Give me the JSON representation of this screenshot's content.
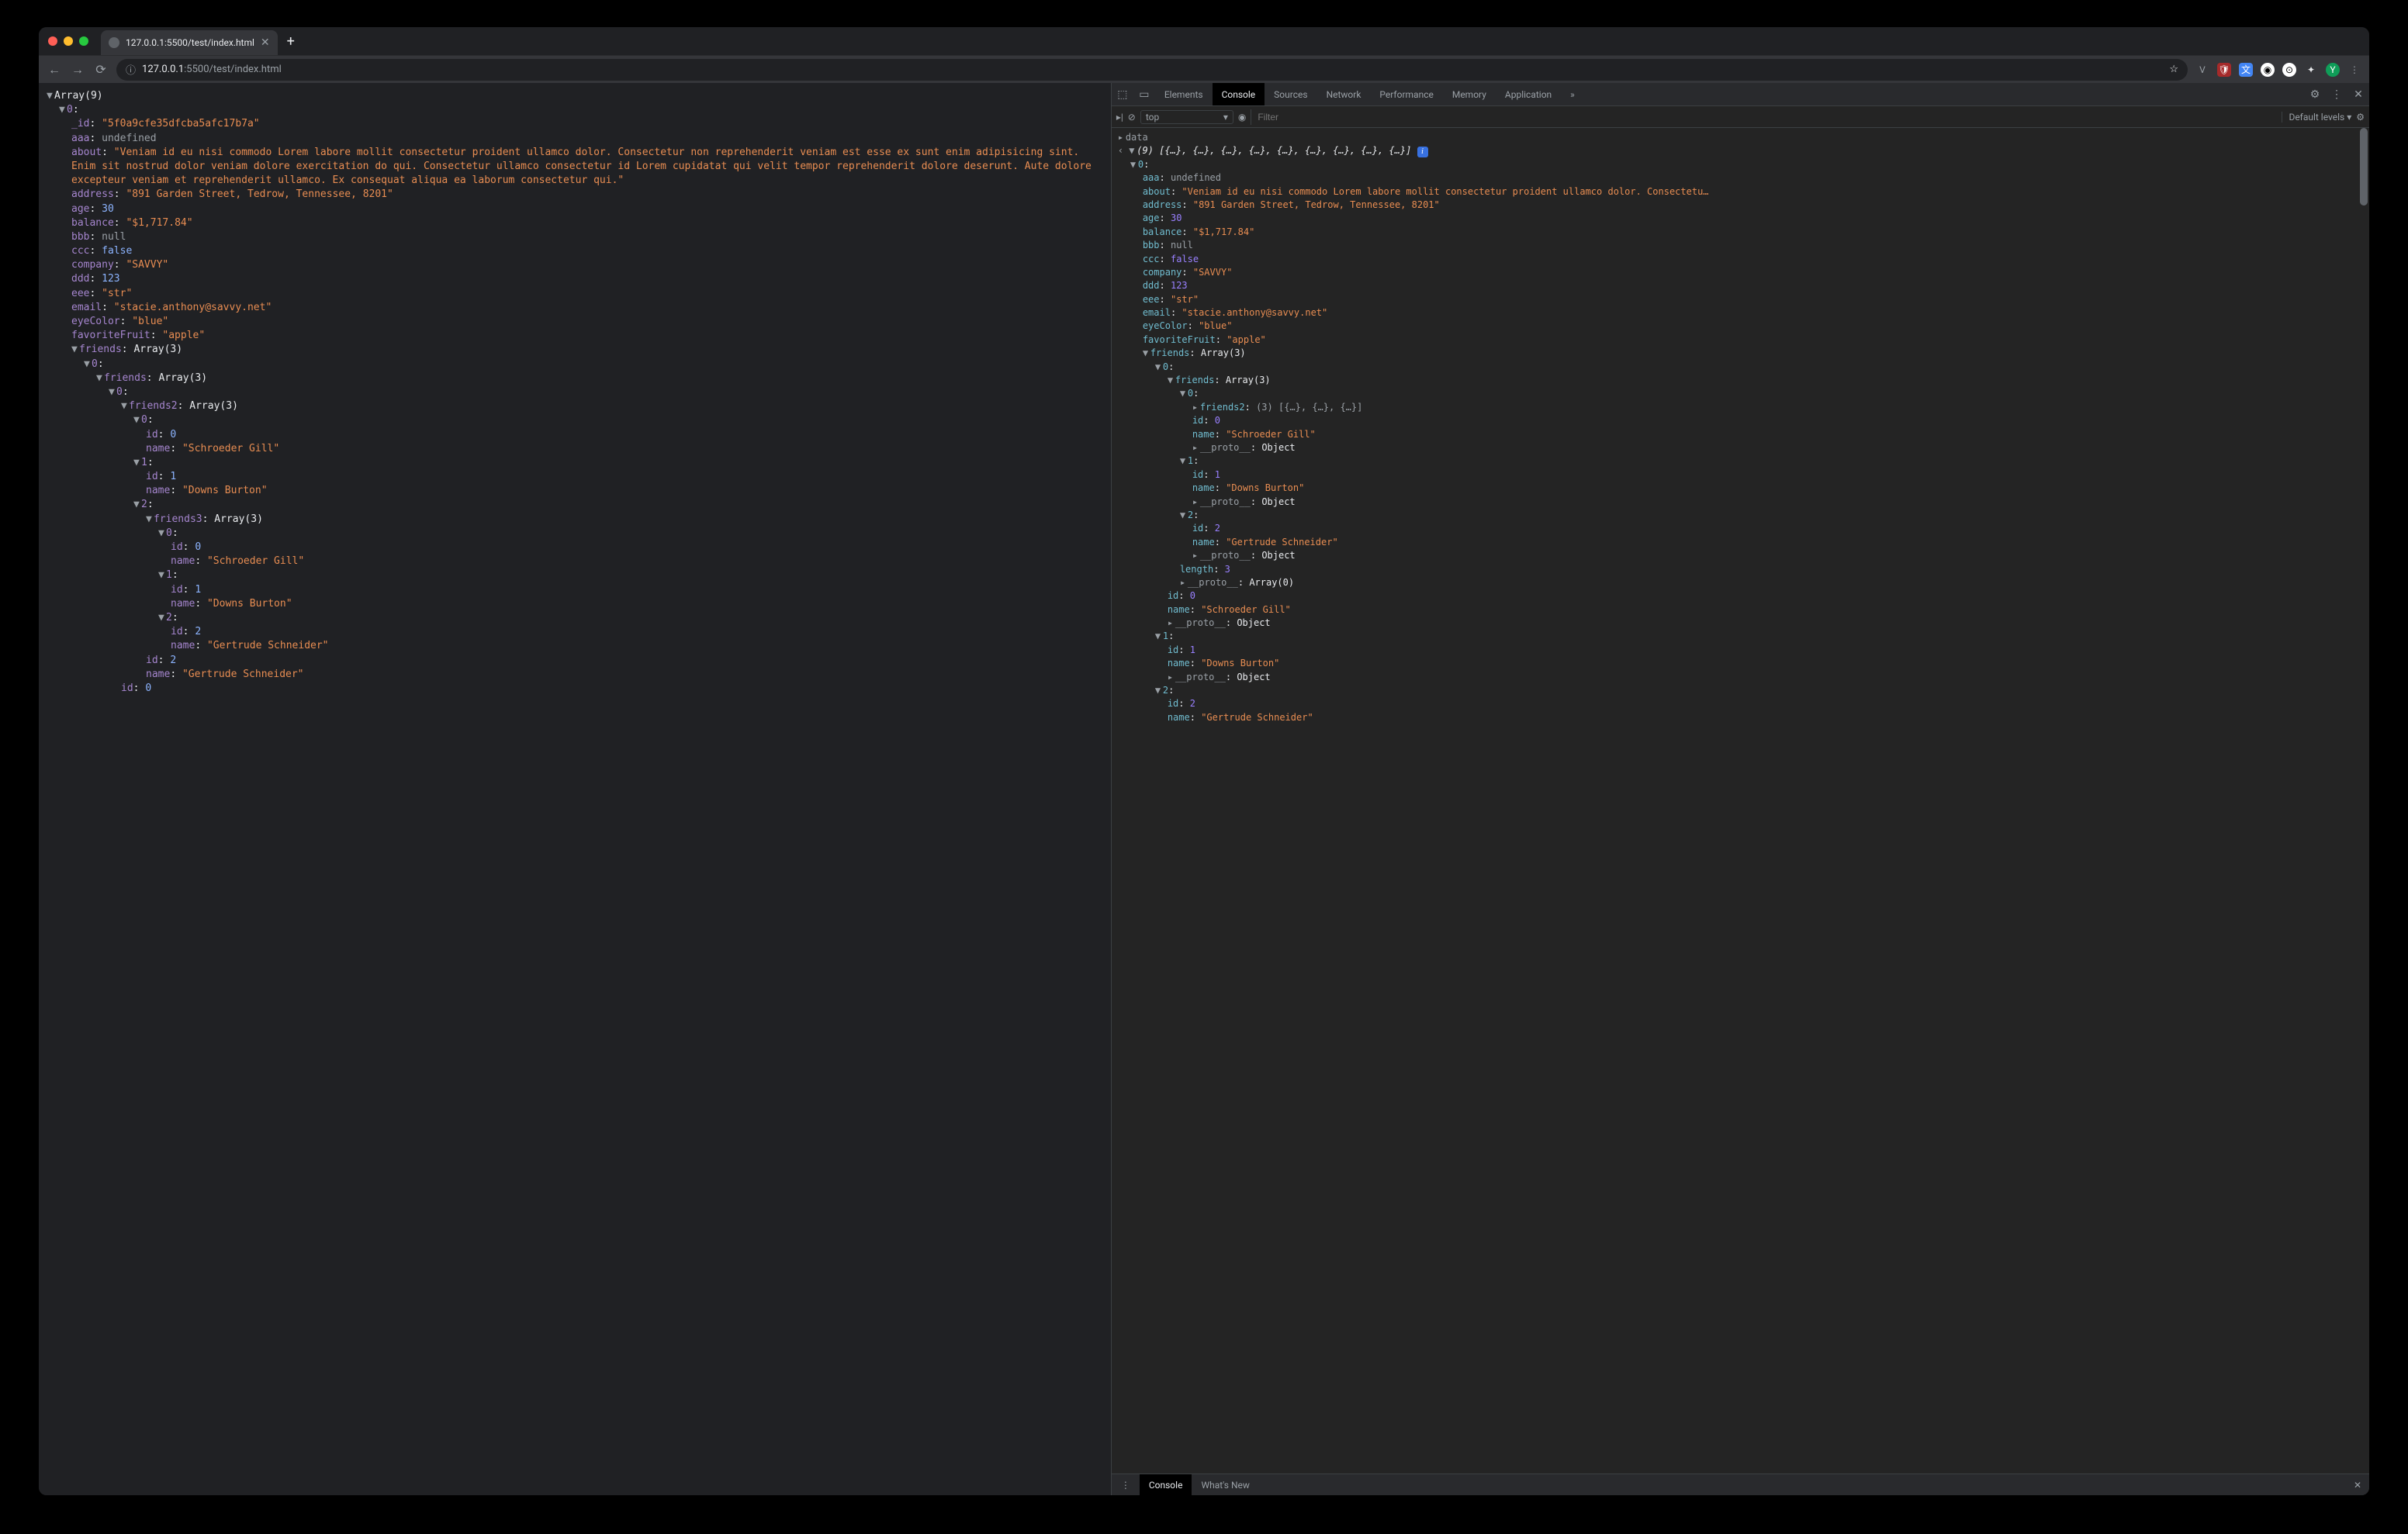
{
  "browser": {
    "tab_title": "127.0.0.1:5500/test/index.html",
    "url_info": "ⓘ",
    "url_host": "127.0.0.1",
    "url_port_path": ":5500/test/index.html",
    "star": "☆",
    "avatar_letter": "Y",
    "newtab": "+",
    "back": "←",
    "fwd": "→",
    "reload": "⟳",
    "ext_v": "V",
    "ext_puzzle": "✦",
    "ext_more": "⋮",
    "ext_gh": "⊙",
    "ext_robot": "◉",
    "ext_trans": "文",
    "ext_shield": "🛡"
  },
  "devtools": {
    "tabs": {
      "elements": "Elements",
      "console": "Console",
      "sources": "Sources",
      "network": "Network",
      "performance": "Performance",
      "memory": "Memory",
      "application": "Application",
      "more": "»",
      "settings": "⚙",
      "menu": "⋮",
      "close": "✕"
    },
    "toolbar": {
      "clear": "⊘",
      "context": "top",
      "context_arrow": "▾",
      "eye": "◉",
      "filter_placeholder": "Filter",
      "levels": "Default levels ▾",
      "gear": "⚙",
      "side": "▸|"
    },
    "drawer": {
      "menu": "⋮",
      "console": "Console",
      "whatsnew": "What's New",
      "close": "✕"
    }
  },
  "page_tree": {
    "root": "Array(9)",
    "idx0": "0",
    "_id_k": "_id",
    "_id_v": "\"5f0a9cfe35dfcba5afc17b7a\"",
    "aaa_k": "aaa",
    "aaa_v": "undefined",
    "about_k": "about",
    "about_v": "\"Veniam id eu nisi commodo Lorem labore mollit consectetur proident ullamco dolor. Consectetur non reprehenderit veniam est esse ex sunt enim adipisicing sint. Enim sit nostrud dolor veniam dolore exercitation do qui. Consectetur ullamco consectetur id Lorem cupidatat qui velit tempor reprehenderit dolore deserunt. Aute dolore excepteur veniam et reprehenderit ullamco. Ex consequat aliqua ea laborum consectetur qui.\"",
    "address_k": "address",
    "address_v": "\"891 Garden Street, Tedrow, Tennessee, 8201\"",
    "age_k": "age",
    "age_v": "30",
    "balance_k": "balance",
    "balance_v": "\"$1,717.84\"",
    "bbb_k": "bbb",
    "bbb_v": "null",
    "ccc_k": "ccc",
    "ccc_v": "false",
    "company_k": "company",
    "company_v": "\"SAVVY\"",
    "ddd_k": "ddd",
    "ddd_v": "123",
    "eee_k": "eee",
    "eee_v": "\"str\"",
    "email_k": "email",
    "email_v": "\"stacie.anthony@savvy.net\"",
    "eyeColor_k": "eyeColor",
    "eyeColor_v": "\"blue\"",
    "favoriteFruit_k": "favoriteFruit",
    "favoriteFruit_v": "\"apple\"",
    "friends_k": "friends",
    "friends_v": "Array(3)",
    "f0": "0",
    "f0_friends_k": "friends",
    "f0_friends_v": "Array(3)",
    "f00": "0",
    "f00_friends2_k": "friends2",
    "f00_friends2_v": "Array(3)",
    "f000": "0",
    "f000_id_k": "id",
    "f000_id_v": "0",
    "f000_name_k": "name",
    "f000_name_v": "\"Schroeder Gill\"",
    "f001": "1",
    "f001_id_k": "id",
    "f001_id_v": "1",
    "f001_name_k": "name",
    "f001_name_v": "\"Downs Burton\"",
    "f002": "2",
    "f002_friends3_k": "friends3",
    "f002_friends3_v": "Array(3)",
    "f0020": "0",
    "f0020_id_k": "id",
    "f0020_id_v": "0",
    "f0020_name_k": "name",
    "f0020_name_v": "\"Schroeder Gill\"",
    "f0021": "1",
    "f0021_id_k": "id",
    "f0021_id_v": "1",
    "f0021_name_k": "name",
    "f0021_name_v": "\"Downs Burton\"",
    "f0022": "2",
    "f0022_id_k": "id",
    "f0022_id_v": "2",
    "f0022_name_k": "name",
    "f0022_name_v": "\"Gertrude Schneider\"",
    "f002_id_k": "id",
    "f002_id_v": "2",
    "f002_name_k": "name",
    "f002_name_v": "\"Gertrude Schneider\"",
    "f00_id_k": "id",
    "f00_id_v": "0"
  },
  "console": {
    "prompt": "‹",
    "data_label": "data",
    "summary": "(9) [{…}, {…}, {…}, {…}, {…}, {…}, {…}, {…}, {…}]",
    "i": "i",
    "idx0": "0",
    "aaa_k": "aaa",
    "aaa_v": "undefined",
    "about_k": "about",
    "about_v": "\"Veniam id eu nisi commodo Lorem labore mollit consectetur proident ullamco dolor. Consectetu…",
    "address_k": "address",
    "address_v": "\"891 Garden Street, Tedrow, Tennessee, 8201\"",
    "age_k": "age",
    "age_v": "30",
    "balance_k": "balance",
    "balance_v": "\"$1,717.84\"",
    "bbb_k": "bbb",
    "bbb_v": "null",
    "ccc_k": "ccc",
    "ccc_v": "false",
    "company_k": "company",
    "company_v": "\"SAVVY\"",
    "ddd_k": "ddd",
    "ddd_v": "123",
    "eee_k": "eee",
    "eee_v": "\"str\"",
    "email_k": "email",
    "email_v": "\"stacie.anthony@savvy.net\"",
    "eyeColor_k": "eyeColor",
    "eyeColor_v": "\"blue\"",
    "favoriteFruit_k": "favoriteFruit",
    "favoriteFruit_v": "\"apple\"",
    "friends_k": "friends",
    "friends_v": "Array(3)",
    "f0": "0",
    "f0_friends_k": "friends",
    "f0_friends_v": "Array(3)",
    "f00": "0",
    "f00_friends2_k": "friends2",
    "f00_friends2_v": "(3) [{…}, {…}, {…}]",
    "f00_id_k": "id",
    "f00_id_v": "0",
    "f00_name_k": "name",
    "f00_name_v": "\"Schroeder Gill\"",
    "proto_k": "__proto__",
    "proto_v": "Object",
    "f01": "1",
    "f01_id_k": "id",
    "f01_id_v": "1",
    "f01_name_k": "name",
    "f01_name_v": "\"Downs Burton\"",
    "f02": "2",
    "f02_id_k": "id",
    "f02_id_v": "2",
    "f02_name_k": "name",
    "f02_name_v": "\"Gertrude Schneider\"",
    "length_k": "length",
    "length_v": "3",
    "proto_arr_v": "Array(0)",
    "outer_id_k": "id",
    "outer_id_v": "0",
    "outer_name_k": "name",
    "outer_name_v": "\"Schroeder Gill\"",
    "idx1": "1",
    "i1_id_k": "id",
    "i1_id_v": "1",
    "i1_name_k": "name",
    "i1_name_v": "\"Downs Burton\"",
    "idx2": "2",
    "i2_id_k": "id",
    "i2_id_v": "2",
    "i2_name_k": "name",
    "i2_name_v": "\"Gertrude Schneider\""
  }
}
